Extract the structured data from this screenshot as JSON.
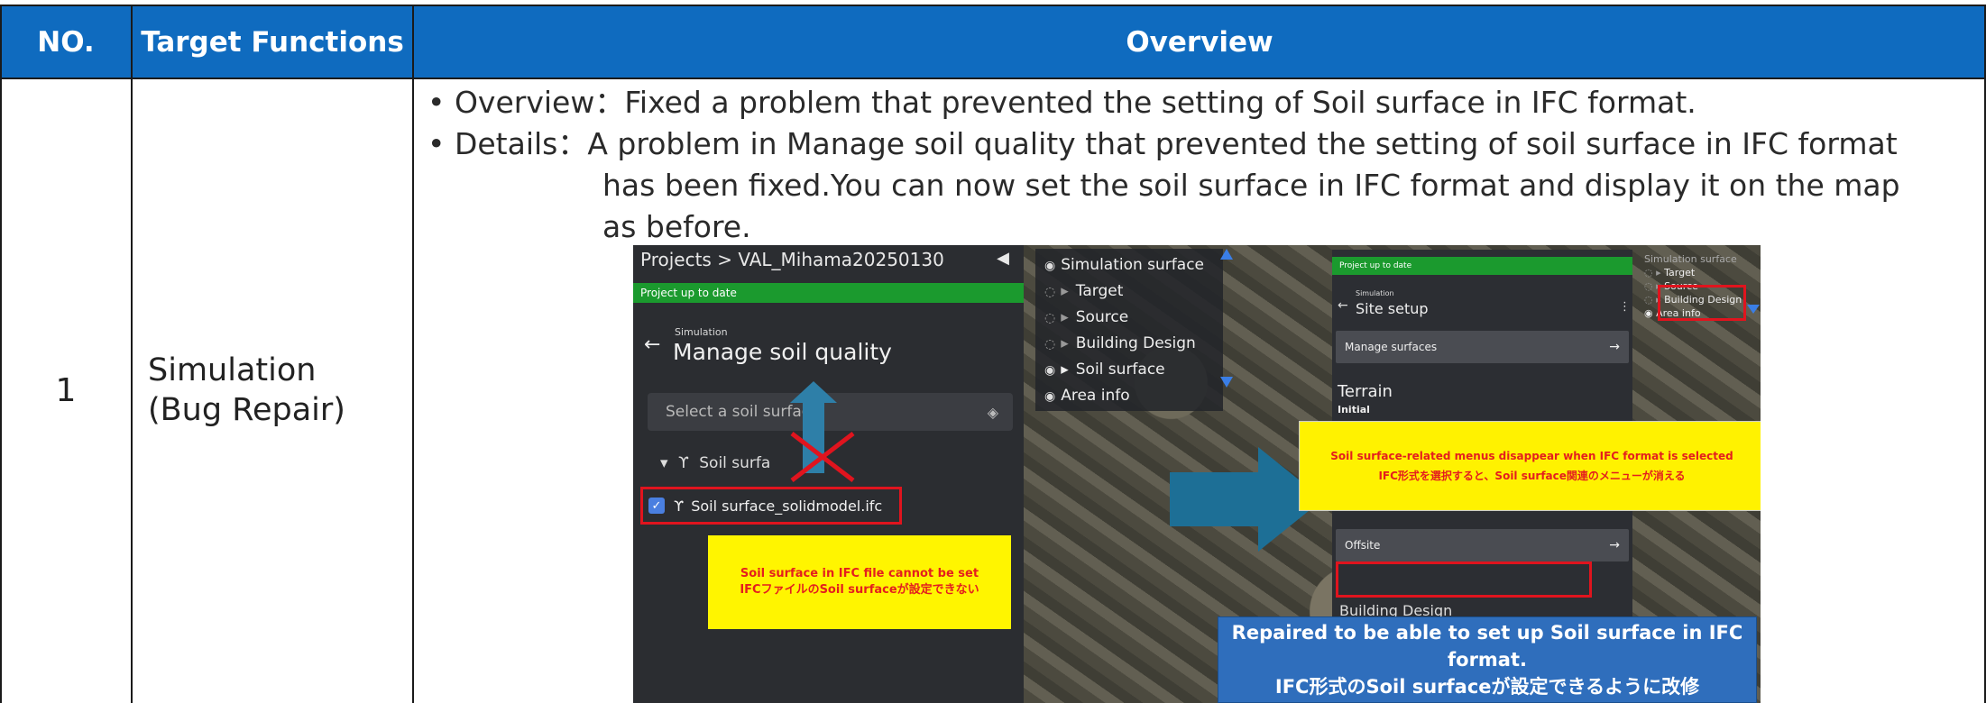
{
  "table": {
    "headers": {
      "no": "NO.",
      "functions": "Target Functions",
      "overview": "Overview"
    },
    "row": {
      "no": "1",
      "function_line1": "Simulation",
      "function_line2": "(Bug Repair)",
      "overview_line1": "• Overview：Fixed a problem that prevented the setting of Soil surface in IFC format.",
      "details_line1": "• Details：A problem in Manage soil quality that prevented the setting of soil surface in IFC format",
      "details_line2": "has been fixed.You can now set the soil surface in IFC format and display it on the map",
      "details_line3": "as before."
    }
  },
  "screenshot": {
    "left_panel": {
      "breadcrumb": "Projects > VAL_Mihama20250130",
      "collapse_icon": "◀",
      "status": "Project up to date",
      "section": "Simulation",
      "back_icon": "←",
      "title": "Manage soil quality",
      "select_placeholder": "Select a soil surface",
      "select_icon": "layers-icon",
      "group_label": "Soil surfa",
      "item_label": "Soil surface_solidmodel.ifc",
      "note_en": "Soil surface in IFC file cannot be set",
      "note_jp": "IFCファイルのSoil surfaceが設定できない"
    },
    "layers": {
      "items": [
        "Simulation surface",
        "Target",
        "Source",
        "Building Design",
        "Soil surface",
        "Area info"
      ]
    },
    "right_panel": {
      "status": "Project up to date",
      "section": "Simulation",
      "title": "Site setup",
      "manage_surfaces": "Manage surfaces",
      "terrain": "Terrain",
      "terrain_sub": "Initial",
      "offsite": "Offsite",
      "building_design": "Building Design",
      "note_en": "Soil surface-related menus disappear when IFC format is selected",
      "note_jp": "IFC形式を選択すると、Soil surface関連のメニューが消える"
    },
    "mini_layers": {
      "items": [
        "Simulation surface",
        "Target",
        "Source",
        "Building Design",
        "Area info"
      ]
    },
    "caption": {
      "line1": "Repaired to be able to set up Soil surface in IFC format.",
      "line2": "IFC形式のSoil surfaceが設定できるように改修"
    }
  },
  "colors": {
    "header_bg": "#0f6bbf",
    "status_green": "#1b9a2e",
    "highlight_red": "#e0141e",
    "note_yellow": "#fff500",
    "arrow_blue": "#2e7fa8",
    "caption_blue": "#2f6ebc"
  }
}
